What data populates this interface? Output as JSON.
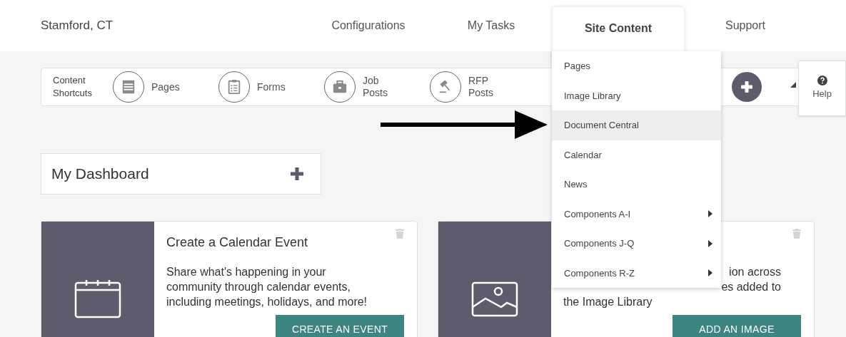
{
  "site_name": "Stamford, CT",
  "nav": [
    {
      "label": "Configurations",
      "selected": false
    },
    {
      "label": "My Tasks",
      "selected": false
    },
    {
      "label": "Site Content",
      "selected": true
    },
    {
      "label": "Support",
      "selected": false
    }
  ],
  "shortcuts": {
    "label": "Content Shortcuts",
    "items": [
      {
        "kind": "pages",
        "label": "Pages"
      },
      {
        "kind": "forms",
        "label": "Forms"
      },
      {
        "kind": "jobs",
        "label": "Job Posts"
      },
      {
        "kind": "rfp",
        "label": "RFP Posts"
      }
    ]
  },
  "help": {
    "label": "Help"
  },
  "dropdown": [
    {
      "label": "Pages",
      "selected": false,
      "submenu": false
    },
    {
      "label": "Image Library",
      "selected": false,
      "submenu": false
    },
    {
      "label": "Document Central",
      "selected": true,
      "submenu": false
    },
    {
      "label": "Calendar",
      "selected": false,
      "submenu": false
    },
    {
      "label": "News",
      "selected": false,
      "submenu": false
    },
    {
      "label": "Components A-I",
      "selected": false,
      "submenu": true
    },
    {
      "label": "Components J-Q",
      "selected": false,
      "submenu": true
    },
    {
      "label": "Components R-Z",
      "selected": false,
      "submenu": true
    }
  ],
  "dashboard": {
    "title": "My Dashboard"
  },
  "cards": [
    {
      "kind": "calendar",
      "title": "Create a Calendar Event",
      "lines": [
        {
          "kind": "full",
          "text": "Share what's happening in your"
        },
        {
          "kind": "full",
          "text": "community through calendar events,"
        },
        {
          "kind": "full",
          "text": "including meetings, holidays, and more!"
        }
      ],
      "button": "CREATE AN EVENT"
    },
    {
      "kind": "image",
      "lines": [
        {
          "kind": "partial",
          "text": "ion across"
        },
        {
          "kind": "partial",
          "text": "es added to"
        },
        {
          "kind": "full",
          "text": "the Image Library"
        }
      ],
      "button": "ADD AN IMAGE"
    }
  ]
}
